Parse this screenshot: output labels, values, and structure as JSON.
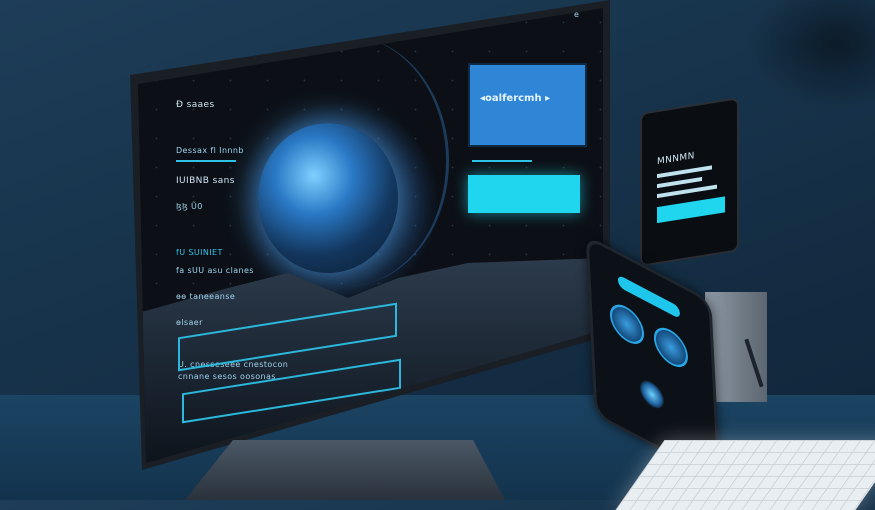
{
  "monitor": {
    "logo_text": "Ð saaes",
    "corner_mark": "ë",
    "left_texts": [
      "Dessax fl Innnb",
      "IUIBNB sans",
      "ɮɮ Ũ0",
      "fU SUINIET",
      "fa sUU asu clanes",
      "ɵɵ taneeanse",
      "ɵlsaer",
      "U. cnesseseee cnestocon",
      "cnnane sesos oosonas"
    ],
    "panel_title": "◂oalfercmh ▸",
    "cta_label": ""
  },
  "tablet": {
    "lines": [
      "MNNMN"
    ]
  },
  "colors": {
    "accent": "#1fd6ee",
    "panel_blue": "#2f86d6",
    "screen_bg": "#0c1016"
  }
}
